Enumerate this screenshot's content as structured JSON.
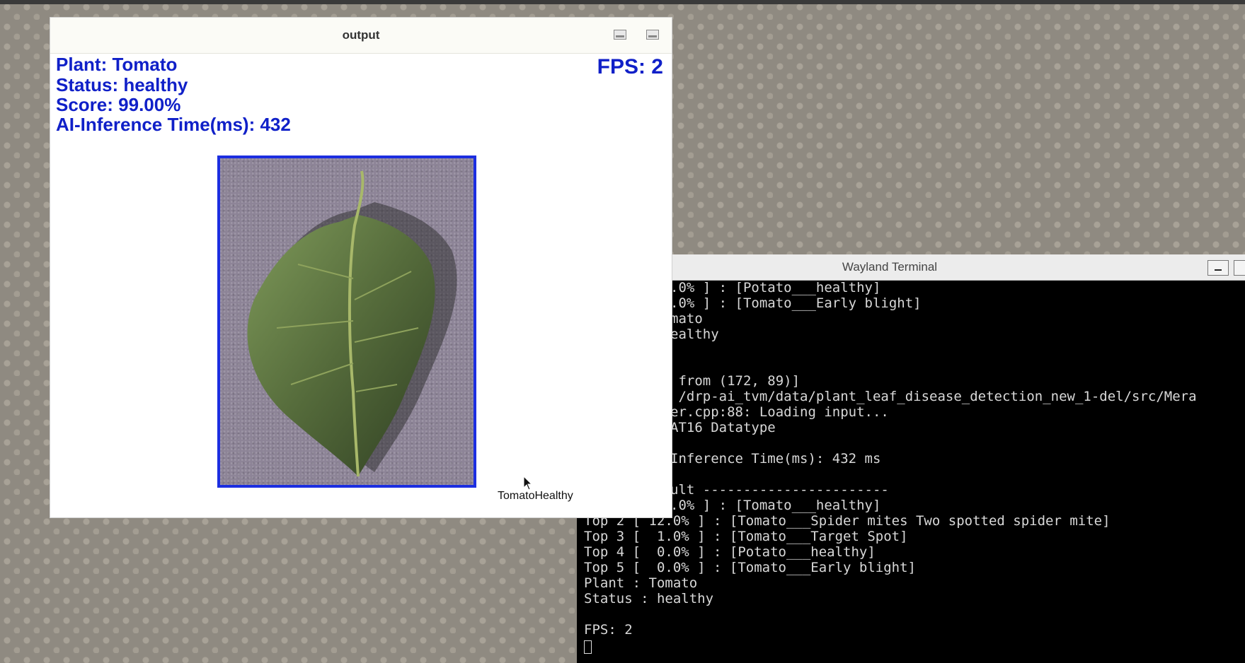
{
  "output_window": {
    "title": "output",
    "overlay": {
      "plant": "Plant: Tomato",
      "status": "Status: healthy",
      "score": "Score: 99.00%",
      "inference": "AI-Inference Time(ms): 432",
      "fps": "FPS: 2"
    },
    "image_caption": "TomatoHealthy",
    "accent_color": "#1c2ee0"
  },
  "terminal": {
    "title": "Wayland Terminal",
    "lines": [
      ".0% ] : [Potato___healthy]",
      ".0% ] : [Tomato___Early blight]",
      "mato",
      "ealthy",
      "",
      "",
      " from (172, 89)]",
      " /drp-ai_tvm/data/plant_leaf_disease_detection_new_1-del/src/Mera",
      "er.cpp:88: Loading input...",
      "AT16 Datatype",
      "",
      "Inference Time(ms): 432 ms",
      "",
      "ult -----------------------",
      ".0% ] : [Tomato___healthy]",
      "Top 2 [ 12.0% ] : [Tomato___Spider mites Two spotted spider mite]",
      "Top 3 [  1.0% ] : [Tomato___Target Spot]",
      "Top 4 [  0.0% ] : [Potato___healthy]",
      "Top 5 [  0.0% ] : [Tomato___Early blight]",
      "Plant : Tomato",
      "Status : healthy",
      "",
      "FPS: 2"
    ]
  }
}
